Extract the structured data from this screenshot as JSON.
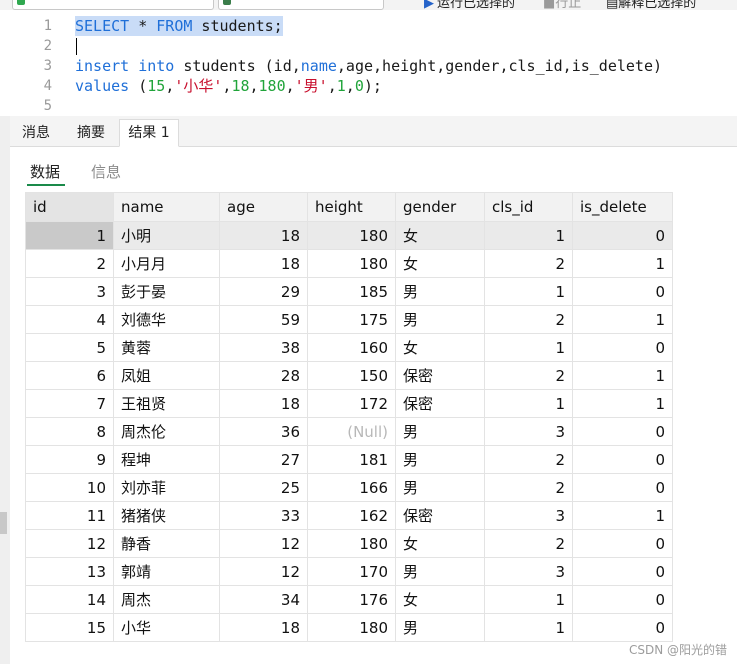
{
  "toolbar": {
    "run_selected": "运行已选择的",
    "run_line": "行止",
    "explain_selected": "解释已选择的"
  },
  "editor": {
    "lines": [
      {
        "num": "1",
        "tokens": [
          {
            "t": "SELECT",
            "c": "kw"
          },
          {
            "t": " * ",
            "c": ""
          },
          {
            "t": "FROM",
            "c": "kw"
          },
          {
            "t": " students;",
            "c": ""
          }
        ],
        "selected": true
      },
      {
        "num": "2",
        "tokens": [],
        "selected": false
      },
      {
        "num": "3",
        "tokens": [
          {
            "t": "insert",
            "c": "kw"
          },
          {
            "t": " ",
            "c": ""
          },
          {
            "t": "into",
            "c": "kw"
          },
          {
            "t": " students (id,",
            "c": ""
          },
          {
            "t": "name",
            "c": "kw"
          },
          {
            "t": ",age,height,gender,cls_id,is_delete)",
            "c": ""
          }
        ],
        "selected": false
      },
      {
        "num": "4",
        "tokens": [
          {
            "t": "values",
            "c": "kw"
          },
          {
            "t": " (",
            "c": ""
          },
          {
            "t": "15",
            "c": "num"
          },
          {
            "t": ",",
            "c": ""
          },
          {
            "t": "'小华'",
            "c": "str"
          },
          {
            "t": ",",
            "c": ""
          },
          {
            "t": "18",
            "c": "num"
          },
          {
            "t": ",",
            "c": ""
          },
          {
            "t": "180",
            "c": "num"
          },
          {
            "t": ",",
            "c": ""
          },
          {
            "t": "'男'",
            "c": "str"
          },
          {
            "t": ",",
            "c": ""
          },
          {
            "t": "1",
            "c": "num"
          },
          {
            "t": ",",
            "c": ""
          },
          {
            "t": "0",
            "c": "num"
          },
          {
            "t": ");",
            "c": ""
          }
        ],
        "selected": false
      },
      {
        "num": "5",
        "tokens": [],
        "selected": false
      }
    ]
  },
  "tabs": [
    {
      "label": "消息",
      "active": false
    },
    {
      "label": "摘要",
      "active": false
    },
    {
      "label": "结果 1",
      "active": true
    }
  ],
  "subtabs": [
    {
      "label": "数据",
      "active": true
    },
    {
      "label": "信息",
      "active": false
    }
  ],
  "grid": {
    "columns": [
      "id",
      "name",
      "age",
      "height",
      "gender",
      "cls_id",
      "is_delete"
    ],
    "null_text": "(Null)",
    "rows": [
      [
        "1",
        "小明",
        "18",
        "180",
        "女",
        "1",
        "0"
      ],
      [
        "2",
        "小月月",
        "18",
        "180",
        "女",
        "2",
        "1"
      ],
      [
        "3",
        "彭于晏",
        "29",
        "185",
        "男",
        "1",
        "0"
      ],
      [
        "4",
        "刘德华",
        "59",
        "175",
        "男",
        "2",
        "1"
      ],
      [
        "5",
        "黄蓉",
        "38",
        "160",
        "女",
        "1",
        "0"
      ],
      [
        "6",
        "凤姐",
        "28",
        "150",
        "保密",
        "2",
        "1"
      ],
      [
        "7",
        "王祖贤",
        "18",
        "172",
        "保密",
        "1",
        "1"
      ],
      [
        "8",
        "周杰伦",
        "36",
        null,
        "男",
        "3",
        "0"
      ],
      [
        "9",
        "程坤",
        "27",
        "181",
        "男",
        "2",
        "0"
      ],
      [
        "10",
        "刘亦菲",
        "25",
        "166",
        "男",
        "2",
        "0"
      ],
      [
        "11",
        "猪猪侠",
        "33",
        "162",
        "保密",
        "3",
        "1"
      ],
      [
        "12",
        "静香",
        "12",
        "180",
        "女",
        "2",
        "0"
      ],
      [
        "13",
        "郭靖",
        "12",
        "170",
        "男",
        "3",
        "0"
      ],
      [
        "14",
        "周杰",
        "34",
        "176",
        "女",
        "1",
        "0"
      ],
      [
        "15",
        "小华",
        "18",
        "180",
        "男",
        "1",
        "0"
      ]
    ],
    "selected_row": 0
  },
  "watermark": "CSDN @阳光的错"
}
